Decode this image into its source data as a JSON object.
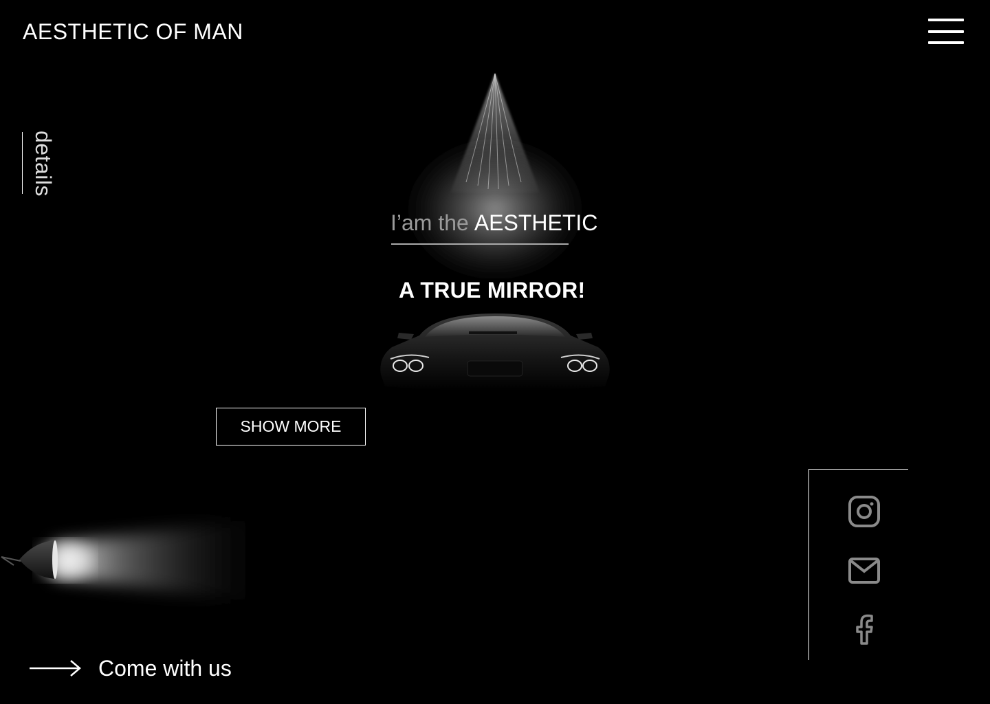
{
  "header": {
    "brand": "AESTHETIC OF MAN",
    "menu_icon": "hamburger-menu-icon"
  },
  "sidebar": {
    "label": "details"
  },
  "hero": {
    "tagline_dim": "I’am the",
    "tagline_bright": "AESTHETIC",
    "headline": "A TRUE MIRROR!",
    "show_more_label": "SHOW MORE"
  },
  "footer": {
    "cta_label": "Come with us",
    "cta_icon": "long-arrow-right-icon"
  },
  "social": {
    "icons": [
      "instagram-icon",
      "mail-icon",
      "facebook-icon"
    ],
    "icon_color": "#8a8a8a"
  },
  "colors": {
    "background": "#000000",
    "text": "#ffffff",
    "dim_text": "#9a9a9a"
  }
}
